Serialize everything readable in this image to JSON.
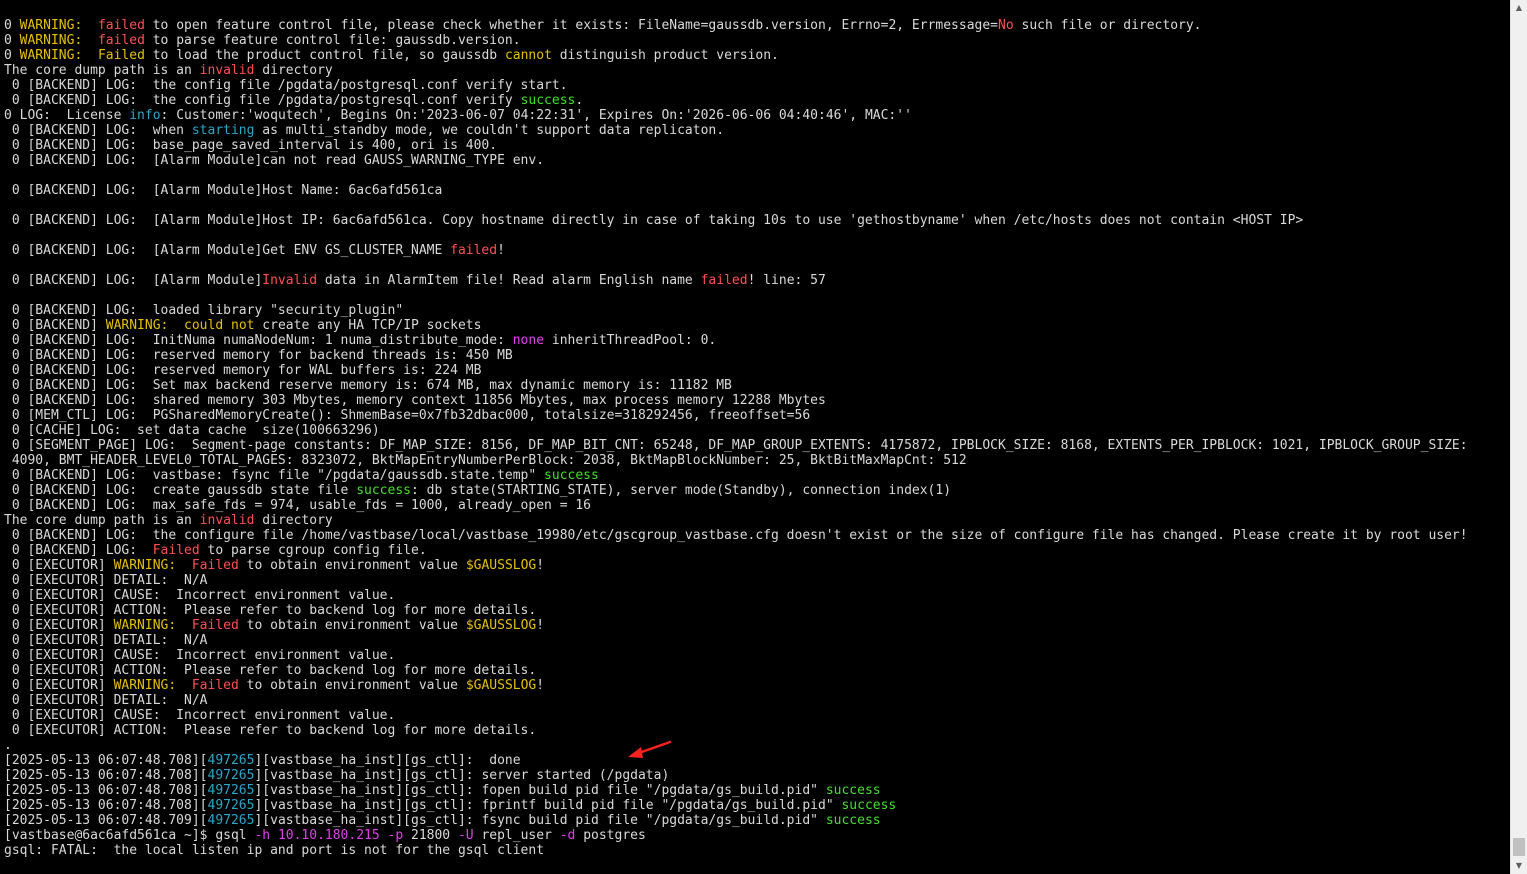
{
  "terminal": {
    "colors": {
      "default": "#d9d9d9",
      "warning": "#e5c000",
      "error": "#ff5050",
      "success": "#44e02a",
      "pid": "#2aa7c9",
      "highlight": "#e040e8",
      "background": "#000000",
      "annotation": "#ff2020"
    },
    "lines": [
      [
        {
          "t": "0 ",
          "c": "w"
        },
        {
          "t": "WARNING:",
          "c": "y"
        },
        {
          "t": "  ",
          "c": "w"
        },
        {
          "t": "failed",
          "c": "r"
        },
        {
          "t": " to open feature control file, please check whether it exists: FileName=gaussdb.version, Errno=2, Errmessage=",
          "c": "w"
        },
        {
          "t": "No",
          "c": "r"
        },
        {
          "t": " such file or directory.",
          "c": "w"
        }
      ],
      [
        {
          "t": "0 ",
          "c": "w"
        },
        {
          "t": "WARNING:",
          "c": "y"
        },
        {
          "t": "  ",
          "c": "w"
        },
        {
          "t": "failed",
          "c": "r"
        },
        {
          "t": " to parse feature control file: gaussdb.version.",
          "c": "w"
        }
      ],
      [
        {
          "t": "0 ",
          "c": "w"
        },
        {
          "t": "WARNING:",
          "c": "y"
        },
        {
          "t": "  ",
          "c": "w"
        },
        {
          "t": "Failed",
          "c": "y"
        },
        {
          "t": " to load the product control file, so gaussdb ",
          "c": "w"
        },
        {
          "t": "cannot",
          "c": "y"
        },
        {
          "t": " distinguish product version.",
          "c": "w"
        }
      ],
      [
        {
          "t": "The core dump path is an ",
          "c": "w"
        },
        {
          "t": "invalid",
          "c": "r"
        },
        {
          "t": " directory",
          "c": "w"
        }
      ],
      [
        {
          "t": " 0 [BACKEND] LOG:  the config file /pgdata/postgresql.conf verify start.",
          "c": "w"
        }
      ],
      [
        {
          "t": " 0 [BACKEND] LOG:  the config file /pgdata/postgresql.conf verify ",
          "c": "w"
        },
        {
          "t": "success",
          "c": "g"
        },
        {
          "t": ".",
          "c": "w"
        }
      ],
      [
        {
          "t": "0 LOG:  License ",
          "c": "w"
        },
        {
          "t": "info",
          "c": "c"
        },
        {
          "t": ": Customer:'woqutech', Begins On:'2023-06-07 04:22:31', Expires On:'2026-06-06 04:40:46', MAC:''",
          "c": "w"
        }
      ],
      [
        {
          "t": " 0 [BACKEND] LOG:  when ",
          "c": "w"
        },
        {
          "t": "starting",
          "c": "c"
        },
        {
          "t": " as multi_standby mode, we couldn't support data replicaton.",
          "c": "w"
        }
      ],
      [
        {
          "t": " 0 [BACKEND] LOG:  base_page_saved_interval is 400, ori is 400.",
          "c": "w"
        }
      ],
      [
        {
          "t": " 0 [BACKEND] LOG:  [Alarm Module]can not read GAUSS_WARNING_TYPE env.",
          "c": "w"
        }
      ],
      [
        {
          "t": "",
          "c": "w"
        }
      ],
      [
        {
          "t": " 0 [BACKEND] LOG:  [Alarm Module]Host Name: 6ac6afd561ca",
          "c": "w"
        }
      ],
      [
        {
          "t": "",
          "c": "w"
        }
      ],
      [
        {
          "t": " 0 [BACKEND] LOG:  [Alarm Module]Host IP: 6ac6afd561ca. Copy hostname directly in case of taking 10s to use 'gethostbyname' when /etc/hosts does not contain <HOST IP>",
          "c": "w"
        }
      ],
      [
        {
          "t": "",
          "c": "w"
        }
      ],
      [
        {
          "t": " 0 [BACKEND] LOG:  [Alarm Module]Get ENV GS_CLUSTER_NAME ",
          "c": "w"
        },
        {
          "t": "failed",
          "c": "r"
        },
        {
          "t": "!",
          "c": "w"
        }
      ],
      [
        {
          "t": "",
          "c": "w"
        }
      ],
      [
        {
          "t": " 0 [BACKEND] LOG:  [Alarm Module]",
          "c": "w"
        },
        {
          "t": "Invalid",
          "c": "r"
        },
        {
          "t": " data in AlarmItem file! Read alarm English name ",
          "c": "w"
        },
        {
          "t": "failed",
          "c": "r"
        },
        {
          "t": "! line: 57",
          "c": "w"
        }
      ],
      [
        {
          "t": "",
          "c": "w"
        }
      ],
      [
        {
          "t": " 0 [BACKEND] LOG:  loaded library \"security_plugin\"",
          "c": "w"
        }
      ],
      [
        {
          "t": " 0 [BACKEND] ",
          "c": "w"
        },
        {
          "t": "WARNING:",
          "c": "y"
        },
        {
          "t": "  ",
          "c": "w"
        },
        {
          "t": "could not",
          "c": "y"
        },
        {
          "t": " create any HA TCP/IP sockets",
          "c": "w"
        }
      ],
      [
        {
          "t": " 0 [BACKEND] LOG:  InitNuma numaNodeNum: 1 numa_distribute_mode: ",
          "c": "w"
        },
        {
          "t": "none",
          "c": "m"
        },
        {
          "t": " inheritThreadPool: 0.",
          "c": "w"
        }
      ],
      [
        {
          "t": " 0 [BACKEND] LOG:  reserved memory for backend threads is: 450 MB",
          "c": "w"
        }
      ],
      [
        {
          "t": " 0 [BACKEND] LOG:  reserved memory for WAL buffers is: 224 MB",
          "c": "w"
        }
      ],
      [
        {
          "t": " 0 [BACKEND] LOG:  Set max backend reserve memory is: 674 MB, max dynamic memory is: 11182 MB",
          "c": "w"
        }
      ],
      [
        {
          "t": " 0 [BACKEND] LOG:  shared memory 303 Mbytes, memory context 11856 Mbytes, max process memory 12288 Mbytes",
          "c": "w"
        }
      ],
      [
        {
          "t": " 0 [MEM_CTL] LOG:  PGSharedMemoryCreate(): ShmemBase=0x7fb32dbac000, totalsize=318292456, freeoffset=56",
          "c": "w"
        }
      ],
      [
        {
          "t": " 0 [CACHE] LOG:  set data cache  size(100663296)",
          "c": "w"
        }
      ],
      [
        {
          "t": " 0 [SEGMENT_PAGE] LOG:  Segment-page constants: DF_MAP_SIZE: 8156, DF_MAP_BIT_CNT: 65248, DF_MAP_GROUP_EXTENTS: 4175872, IPBLOCK_SIZE: 8168, EXTENTS_PER_IPBLOCK: 1021, IPBLOCK_GROUP_SIZE:",
          "c": "w"
        }
      ],
      [
        {
          "t": " 4090, BMT_HEADER_LEVEL0_TOTAL_PAGES: 8323072, BktMapEntryNumberPerBlock: 2038, BktMapBlockNumber: 25, BktBitMaxMapCnt: 512",
          "c": "w"
        }
      ],
      [
        {
          "t": " 0 [BACKEND] LOG:  vastbase: fsync file \"/pgdata/gaussdb.state.temp\" ",
          "c": "w"
        },
        {
          "t": "success",
          "c": "g"
        }
      ],
      [
        {
          "t": " 0 [BACKEND] LOG:  create gaussdb state file ",
          "c": "w"
        },
        {
          "t": "success",
          "c": "g"
        },
        {
          "t": ": db state(STARTING_STATE), server mode(Standby), connection index(1)",
          "c": "w"
        }
      ],
      [
        {
          "t": " 0 [BACKEND] LOG:  max_safe_fds = 974, usable_fds = 1000, already_open = 16",
          "c": "w"
        }
      ],
      [
        {
          "t": "The core dump path is an ",
          "c": "w"
        },
        {
          "t": "invalid",
          "c": "r"
        },
        {
          "t": " directory",
          "c": "w"
        }
      ],
      [
        {
          "t": " 0 [BACKEND] LOG:  the configure file /home/vastbase/local/vastbase_19980/etc/gscgroup_vastbase.cfg doesn't exist or the size of configure file has changed. Please create it by root user!",
          "c": "w"
        }
      ],
      [
        {
          "t": " 0 [BACKEND] LOG:  ",
          "c": "w"
        },
        {
          "t": "Failed",
          "c": "r"
        },
        {
          "t": " to parse cgroup config file.",
          "c": "w"
        }
      ],
      [
        {
          "t": " 0 [EXECUTOR] ",
          "c": "w"
        },
        {
          "t": "WARNING:",
          "c": "y"
        },
        {
          "t": "  ",
          "c": "w"
        },
        {
          "t": "Failed",
          "c": "r"
        },
        {
          "t": " to obtain environment value ",
          "c": "w"
        },
        {
          "t": "$GAUSSLOG",
          "c": "y"
        },
        {
          "t": "!",
          "c": "w"
        }
      ],
      [
        {
          "t": " 0 [EXECUTOR] DETAIL:  N/A",
          "c": "w"
        }
      ],
      [
        {
          "t": " 0 [EXECUTOR] CAUSE:  Incorrect environment value.",
          "c": "w"
        }
      ],
      [
        {
          "t": " 0 [EXECUTOR] ACTION:  Please refer to backend log for more details.",
          "c": "w"
        }
      ],
      [
        {
          "t": " 0 [EXECUTOR] ",
          "c": "w"
        },
        {
          "t": "WARNING:",
          "c": "y"
        },
        {
          "t": "  ",
          "c": "w"
        },
        {
          "t": "Failed",
          "c": "r"
        },
        {
          "t": " to obtain environment value ",
          "c": "w"
        },
        {
          "t": "$GAUSSLOG",
          "c": "y"
        },
        {
          "t": "!",
          "c": "w"
        }
      ],
      [
        {
          "t": " 0 [EXECUTOR] DETAIL:  N/A",
          "c": "w"
        }
      ],
      [
        {
          "t": " 0 [EXECUTOR] CAUSE:  Incorrect environment value.",
          "c": "w"
        }
      ],
      [
        {
          "t": " 0 [EXECUTOR] ACTION:  Please refer to backend log for more details.",
          "c": "w"
        }
      ],
      [
        {
          "t": " 0 [EXECUTOR] ",
          "c": "w"
        },
        {
          "t": "WARNING:",
          "c": "y"
        },
        {
          "t": "  ",
          "c": "w"
        },
        {
          "t": "Failed",
          "c": "r"
        },
        {
          "t": " to obtain environment value ",
          "c": "w"
        },
        {
          "t": "$GAUSSLOG",
          "c": "y"
        },
        {
          "t": "!",
          "c": "w"
        }
      ],
      [
        {
          "t": " 0 [EXECUTOR] DETAIL:  N/A",
          "c": "w"
        }
      ],
      [
        {
          "t": " 0 [EXECUTOR] CAUSE:  Incorrect environment value.",
          "c": "w"
        }
      ],
      [
        {
          "t": " 0 [EXECUTOR] ACTION:  Please refer to backend log for more details.",
          "c": "w"
        }
      ],
      [
        {
          "t": ".",
          "c": "w"
        }
      ],
      [
        {
          "t": "[2025-05-13 06:07:48.708][",
          "c": "w"
        },
        {
          "t": "497265",
          "c": "c"
        },
        {
          "t": "][vastbase_ha_inst][gs_ctl]:  done",
          "c": "w"
        }
      ],
      [
        {
          "t": "[2025-05-13 06:07:48.708][",
          "c": "w"
        },
        {
          "t": "497265",
          "c": "c"
        },
        {
          "t": "][vastbase_ha_inst][gs_ctl]: server started (/pgdata)",
          "c": "w"
        }
      ],
      [
        {
          "t": "[2025-05-13 06:07:48.708][",
          "c": "w"
        },
        {
          "t": "497265",
          "c": "c"
        },
        {
          "t": "][vastbase_ha_inst][gs_ctl]: fopen build pid file \"/pgdata/gs_build.pid\" ",
          "c": "w"
        },
        {
          "t": "success",
          "c": "g"
        }
      ],
      [
        {
          "t": "[2025-05-13 06:07:48.708][",
          "c": "w"
        },
        {
          "t": "497265",
          "c": "c"
        },
        {
          "t": "][vastbase_ha_inst][gs_ctl]: fprintf build pid file \"/pgdata/gs_build.pid\" ",
          "c": "w"
        },
        {
          "t": "success",
          "c": "g"
        }
      ],
      [
        {
          "t": "[2025-05-13 06:07:48.709][",
          "c": "w"
        },
        {
          "t": "497265",
          "c": "c"
        },
        {
          "t": "][vastbase_ha_inst][gs_ctl]: fsync build pid file \"/pgdata/gs_build.pid\" ",
          "c": "w"
        },
        {
          "t": "success",
          "c": "g"
        }
      ],
      [
        {
          "t": "[vastbase@6ac6afd561ca ~]$ gsql ",
          "c": "w"
        },
        {
          "t": "-h",
          "c": "m"
        },
        {
          "t": " ",
          "c": "w"
        },
        {
          "t": "10.10.180.215",
          "c": "m"
        },
        {
          "t": " ",
          "c": "w"
        },
        {
          "t": "-p",
          "c": "m"
        },
        {
          "t": " 21800 ",
          "c": "w"
        },
        {
          "t": "-U",
          "c": "m"
        },
        {
          "t": " repl_user ",
          "c": "w"
        },
        {
          "t": "-d",
          "c": "m"
        },
        {
          "t": " postgres",
          "c": "w"
        }
      ],
      [
        {
          "t": "gsql: FATAL:  the local listen ip and port is not for the gsql client",
          "c": "w"
        }
      ]
    ]
  },
  "scrollbar": {
    "up_icon": "triangle-up-icon",
    "down_icon": "triangle-down-icon",
    "scroll_position": 0.98
  },
  "annotation": {
    "icon": "red-arrow-icon",
    "color": "#ff2020"
  }
}
